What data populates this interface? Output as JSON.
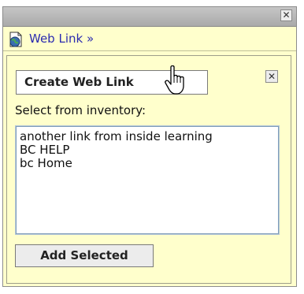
{
  "titlebar": {
    "close_glyph": "✕"
  },
  "header": {
    "title": "Web Link »",
    "icon": "globe-document-icon"
  },
  "panel": {
    "create_button_label": "Create Web Link",
    "close_glyph": "✕",
    "select_label": "Select from inventory:",
    "inventory_items": [
      "another link from inside learning",
      "BC HELP",
      "bc Home"
    ],
    "add_button_label": "Add Selected"
  },
  "colors": {
    "panel_bg": "#ffffcc",
    "link": "#2b2bb0",
    "titlebar": "#b5b5b5"
  }
}
